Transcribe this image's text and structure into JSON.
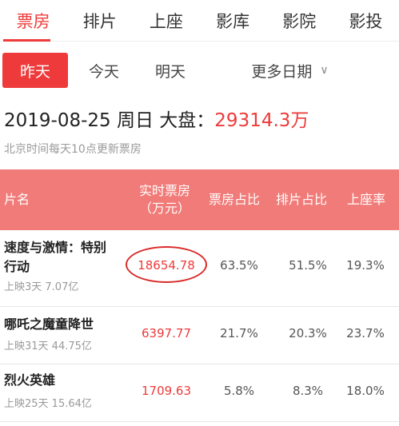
{
  "nav": {
    "tabs": [
      "票房",
      "排片",
      "上座",
      "影库",
      "影院",
      "影投"
    ],
    "active_index": 0
  },
  "dates": {
    "yesterday": "昨天",
    "today": "今天",
    "tomorrow": "明天",
    "more": "更多日期",
    "more_icon": "chevron-down-icon"
  },
  "summary": {
    "date": "2019-08-25",
    "weekday": "周日",
    "label": "大盘：",
    "total": "29314.3万",
    "note": "北京时间每天10点更新票房"
  },
  "table": {
    "headers": {
      "name": "片名",
      "box_line1": "实时票房",
      "box_line2": "（万元）",
      "share": "票房占比",
      "showings": "排片占比",
      "occupancy": "上座率"
    },
    "rows": [
      {
        "name_line1": "速度与激情：特别",
        "name_line2": "行动",
        "meta": "上映3天  7.07亿",
        "box": "18654.78",
        "share": "63.5%",
        "showings": "51.5%",
        "occupancy": "19.3%"
      },
      {
        "name_line1": "哪吒之魔童降世",
        "name_line2": "",
        "meta": "上映31天  44.75亿",
        "box": "6397.77",
        "share": "21.7%",
        "showings": "20.3%",
        "occupancy": "23.7%"
      },
      {
        "name_line1": "烈火英雄",
        "name_line2": "",
        "meta": "上映25天  15.64亿",
        "box": "1709.63",
        "share": "5.8%",
        "showings": "8.3%",
        "occupancy": "18.0%"
      }
    ]
  },
  "colors": {
    "accent": "#ee3a3a",
    "header_bg": "#f07b78"
  }
}
